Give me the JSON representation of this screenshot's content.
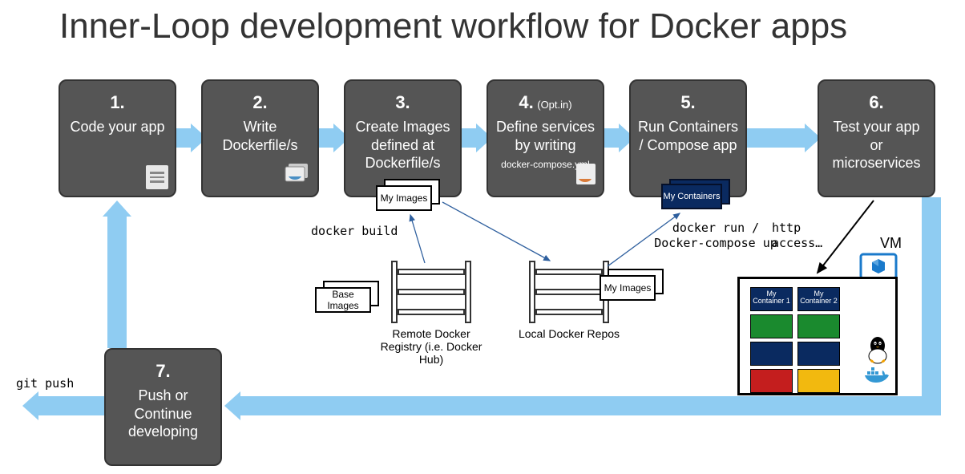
{
  "title": "Inner-Loop development workflow for Docker apps",
  "steps": [
    {
      "num": "1.",
      "label": "Code your app"
    },
    {
      "num": "2.",
      "label": "Write Dockerfile/s"
    },
    {
      "num": "3.",
      "label": "Create Images defined at Dockerfile/s"
    },
    {
      "num": "4.",
      "opt": "(Opt.in)",
      "label": "Define services by writing",
      "sub": "docker-compose.yml"
    },
    {
      "num": "5.",
      "label": "Run Containers / Compose app"
    },
    {
      "num": "6.",
      "label": "Test your app or microservices"
    },
    {
      "num": "7.",
      "label": "Push or Continue developing"
    }
  ],
  "boxes": {
    "my_images": "My Images",
    "base_images": "Base Images",
    "my_containers": "My Containers"
  },
  "labels": {
    "docker_build": "docker build",
    "docker_run": "docker run / Docker-compose up",
    "http_access": "http access…",
    "remote_registry": "Remote Docker Registry (i.e. Docker Hub)",
    "local_repos": "Local Docker Repos",
    "vm": "VM",
    "git_push": "git push"
  },
  "vm": {
    "c1": "My Container 1",
    "c2": "My Container 2"
  }
}
